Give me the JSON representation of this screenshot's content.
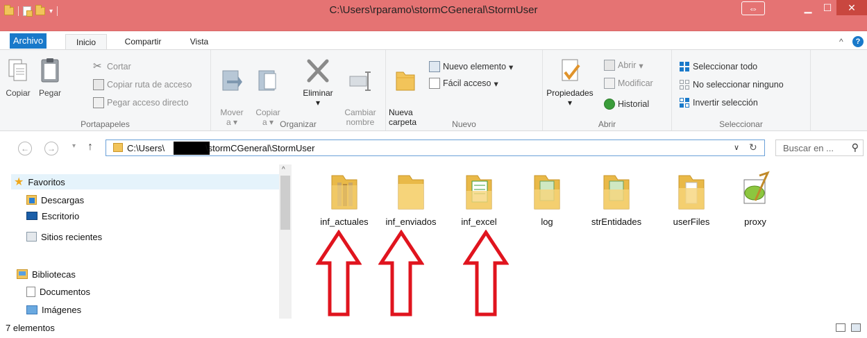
{
  "window": {
    "title": "C:\\Users\\rparamo\\stormCGeneral\\StormUser"
  },
  "tabs": {
    "file": "Archivo",
    "home": "Inicio",
    "share": "Compartir",
    "view": "Vista"
  },
  "ribbon": {
    "clipboard": {
      "label": "Portapapeles",
      "copy": "Copiar",
      "paste": "Pegar",
      "cut": "Cortar",
      "copy_path": "Copiar ruta de acceso",
      "paste_shortcut": "Pegar acceso directo"
    },
    "organize": {
      "label": "Organizar",
      "move_to": "Mover\na",
      "copy_to": "Copiar\na",
      "delete": "Eliminar",
      "rename": "Cambiar\nnombre"
    },
    "new": {
      "label": "Nuevo",
      "new_folder": "Nueva\ncarpeta",
      "new_item": "Nuevo elemento",
      "easy_access": "Fácil acceso"
    },
    "open": {
      "label": "Abrir",
      "properties": "Propiedades",
      "open": "Abrir",
      "edit": "Modificar",
      "history": "Historial"
    },
    "select": {
      "label": "Seleccionar",
      "select_all": "Seleccionar todo",
      "select_none": "No seleccionar ninguno",
      "invert": "Invertir selección"
    }
  },
  "address": {
    "path_start": "C:\\Users\\",
    "path_end": "\\stormCGeneral\\StormUser",
    "search_placeholder": "Buscar en ..."
  },
  "nav": {
    "favorites": "Favoritos",
    "downloads": "Descargas",
    "desktop": "Escritorio",
    "recent": "Sitios recientes",
    "libraries": "Bibliotecas",
    "documents": "Documentos",
    "images": "Imágenes"
  },
  "files": [
    {
      "name": "inf_actuales"
    },
    {
      "name": "inf_enviados"
    },
    {
      "name": "inf_excel"
    },
    {
      "name": "log"
    },
    {
      "name": "strEntidades"
    },
    {
      "name": "userFiles"
    },
    {
      "name": "proxy"
    }
  ],
  "status": {
    "count": "7 elementos"
  },
  "colors": {
    "title_bar": "#e57373",
    "file_tab": "#1979ca",
    "annotation_arrow": "#e0141e"
  }
}
